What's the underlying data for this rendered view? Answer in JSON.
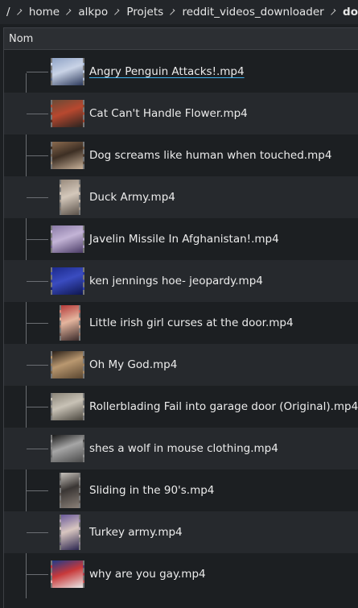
{
  "breadcrumb": {
    "items": [
      "/",
      "home",
      "alkpo",
      "Projets",
      "reddit_videos_downloader",
      "do"
    ]
  },
  "header": {
    "column_name": "Nom"
  },
  "files": [
    {
      "name": "Angry Penguin Attacks!.mp4",
      "thumb": "landscape",
      "colors": [
        "#8fa3c6",
        "#c9d3e6",
        "#2d3a5c"
      ],
      "selected": true
    },
    {
      "name": "Cat Can't Handle Flower.mp4",
      "thumb": "landscape",
      "colors": [
        "#6a4a36",
        "#b8482f",
        "#2a2420"
      ]
    },
    {
      "name": "Dog screams like human when touched.mp4",
      "thumb": "landscape",
      "colors": [
        "#8a6a4e",
        "#3d2f24",
        "#c9b29a"
      ]
    },
    {
      "name": "Duck Army.mp4",
      "thumb": "portrait",
      "colors": [
        "#9a8c7e",
        "#d4c8bb",
        "#5b524a"
      ]
    },
    {
      "name": "Javelin Missile In Afghanistan!.mp4",
      "thumb": "landscape",
      "colors": [
        "#8a7aa6",
        "#c3b4d6",
        "#4a3b66"
      ]
    },
    {
      "name": "ken jennings hoe- jeopardy.mp4",
      "thumb": "landscape",
      "colors": [
        "#1c2a8c",
        "#3a4cc0",
        "#0e1650"
      ]
    },
    {
      "name": "Little irish girl curses at the door.mp4",
      "thumb": "portrait",
      "colors": [
        "#b53a3a",
        "#e4b59e",
        "#3b2a2a"
      ]
    },
    {
      "name": "Oh My God.mp4",
      "thumb": "landscape",
      "colors": [
        "#2a2018",
        "#b99870",
        "#5a4630"
      ]
    },
    {
      "name": "Rollerblading Fail into garage door (Original).mp4",
      "thumb": "landscape",
      "colors": [
        "#8a8478",
        "#c8c2b6",
        "#4a463e"
      ]
    },
    {
      "name": "shes a wolf in mouse clothing.mp4",
      "thumb": "landscape",
      "colors": [
        "#1a1a1a",
        "#a6a6a6",
        "#4a4a4a"
      ]
    },
    {
      "name": "Sliding in the 90's.mp4",
      "thumb": "portrait",
      "colors": [
        "#c7c2bc",
        "#3a3634",
        "#8a8078"
      ]
    },
    {
      "name": "Turkey army.mp4",
      "thumb": "portrait",
      "colors": [
        "#6a5a9a",
        "#d8c6c0",
        "#2c2650"
      ]
    },
    {
      "name": "why are you gay.mp4",
      "thumb": "landscape",
      "colors": [
        "#203a8a",
        "#c8393a",
        "#e8e8e8"
      ]
    }
  ]
}
